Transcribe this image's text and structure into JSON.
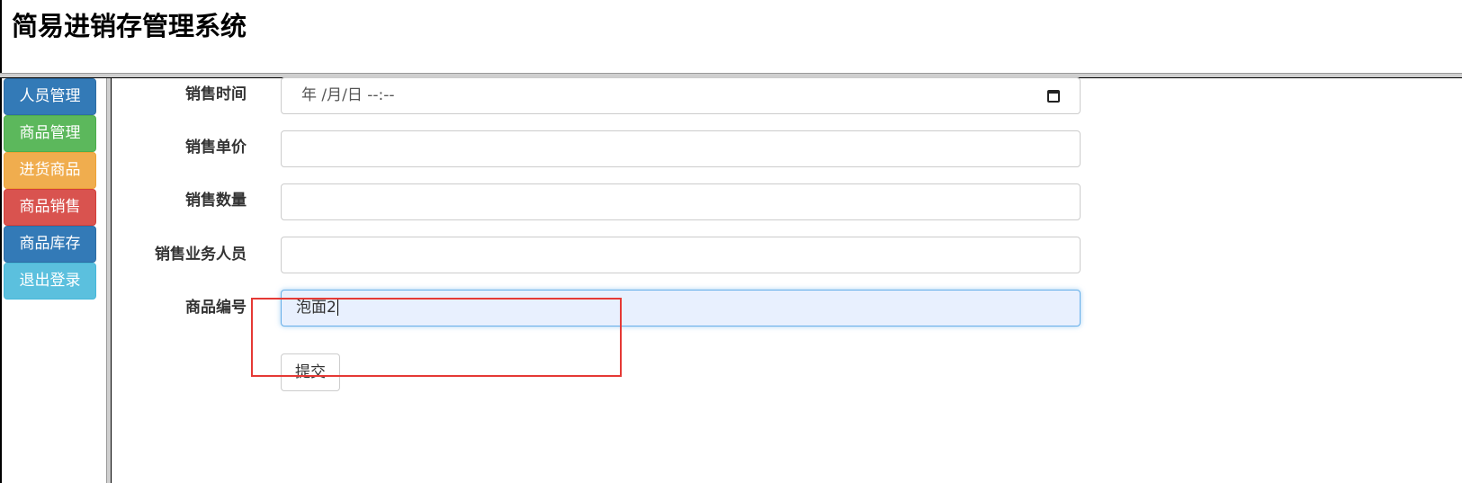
{
  "app": {
    "title": "简易进销存管理系统"
  },
  "sidebar": {
    "items": [
      {
        "label": "人员管理",
        "color": "#337ab7"
      },
      {
        "label": "商品管理",
        "color": "#5cb85c"
      },
      {
        "label": "进货商品",
        "color": "#f0ad4e"
      },
      {
        "label": "商品销售",
        "color": "#d9534f"
      },
      {
        "label": "商品库存",
        "color": "#337ab7"
      },
      {
        "label": "退出登录",
        "color": "#5bc0de"
      }
    ]
  },
  "form": {
    "sale_time": {
      "label": "销售时间",
      "value": "年 /月/日 --:--"
    },
    "unit_price": {
      "label": "销售单价",
      "value": ""
    },
    "quantity": {
      "label": "销售数量",
      "value": ""
    },
    "salesperson": {
      "label": "销售业务人员",
      "value": ""
    },
    "product_id": {
      "label": "商品编号",
      "value": "泡面2"
    },
    "submit_label": "提交"
  },
  "colors": {
    "annotation": "#e53935",
    "focus_border": "#66afe9",
    "focus_bg": "#e8f0fe"
  }
}
